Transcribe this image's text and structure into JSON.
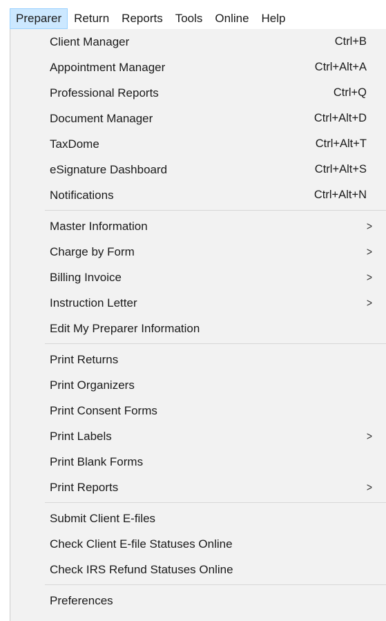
{
  "menubar": {
    "items": [
      {
        "label": "Preparer"
      },
      {
        "label": "Return"
      },
      {
        "label": "Reports"
      },
      {
        "label": "Tools"
      },
      {
        "label": "Online"
      },
      {
        "label": "Help"
      }
    ]
  },
  "menu": {
    "group1": [
      {
        "label": "Client Manager",
        "shortcut": "Ctrl+B"
      },
      {
        "label": "Appointment Manager",
        "shortcut": "Ctrl+Alt+A"
      },
      {
        "label": "Professional Reports",
        "shortcut": "Ctrl+Q"
      },
      {
        "label": "Document Manager",
        "shortcut": "Ctrl+Alt+D"
      },
      {
        "label": "TaxDome",
        "shortcut": "Ctrl+Alt+T"
      },
      {
        "label": "eSignature Dashboard",
        "shortcut": "Ctrl+Alt+S"
      },
      {
        "label": "Notifications",
        "shortcut": "Ctrl+Alt+N"
      }
    ],
    "group2": [
      {
        "label": "Master Information",
        "submenu_glyph": ">"
      },
      {
        "label": "Charge by Form",
        "submenu_glyph": ">"
      },
      {
        "label": "Billing Invoice",
        "submenu_glyph": ">"
      },
      {
        "label": "Instruction Letter",
        "submenu_glyph": ">"
      },
      {
        "label": "Edit My Preparer Information"
      }
    ],
    "group3": [
      {
        "label": "Print Returns"
      },
      {
        "label": "Print Organizers"
      },
      {
        "label": "Print Consent Forms"
      },
      {
        "label": "Print Labels",
        "submenu_glyph": ">"
      },
      {
        "label": "Print Blank Forms"
      },
      {
        "label": "Print Reports",
        "submenu_glyph": ">"
      }
    ],
    "group4": [
      {
        "label": "Submit Client E-files"
      },
      {
        "label": "Check Client E-file Statuses Online"
      },
      {
        "label": "Check IRS Refund Statuses Online"
      }
    ],
    "group5": [
      {
        "label": "Preferences"
      }
    ]
  },
  "colors": {
    "active_menubar_bg": "#cce8ff",
    "active_menubar_border": "#99d1ff",
    "dropdown_bg": "#f2f2f2",
    "separator": "#d7d7d7"
  }
}
